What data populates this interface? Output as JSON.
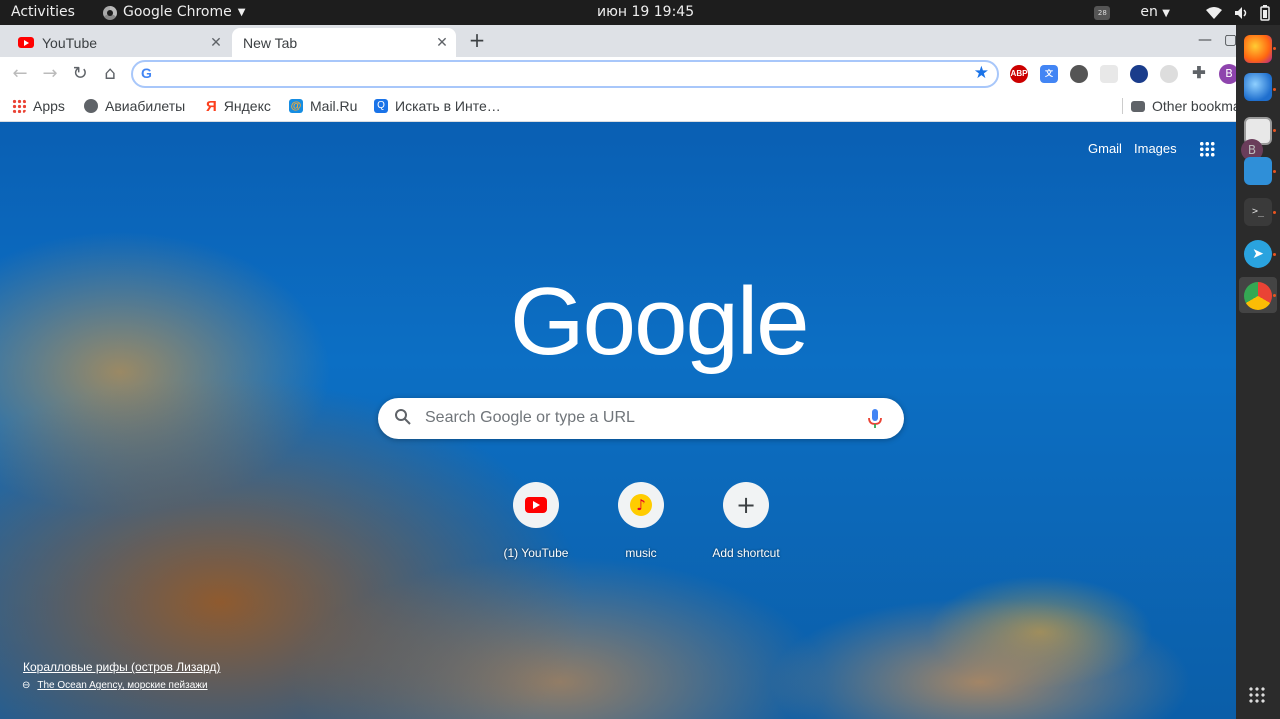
{
  "topbar": {
    "activities": "Activities",
    "app_name": "Google Chrome",
    "clock": "июн 19  19:45",
    "tray_badge": "28",
    "language": "en"
  },
  "tabs": [
    {
      "title": "YouTube",
      "icon": "youtube-icon"
    },
    {
      "title": "New Tab",
      "active": true
    }
  ],
  "omnibox": {
    "value": "",
    "icon": "google-g-icon",
    "g_letter": "G"
  },
  "extensions": [
    "adblock-plus-icon",
    "translate-icon",
    "extension-icon",
    "extension-icon",
    "globe-icon",
    "extension-icon",
    "puzzle-icon"
  ],
  "profile_initial": "B",
  "bookmarks": [
    {
      "label": "Apps",
      "icon": "apps-icon"
    },
    {
      "label": "Авиабилеты",
      "icon": "globe-icon"
    },
    {
      "label": "Яндекс",
      "icon": "yandex-icon"
    },
    {
      "label": "Mail.Ru",
      "icon": "mailru-icon"
    },
    {
      "label": "Искать в Инте…",
      "icon": "search-icon"
    }
  ],
  "other_bookmarks": "Other bookmarks",
  "ntp": {
    "gmail": "Gmail",
    "images": "Images",
    "logo": "Google",
    "search_placeholder": "Search Google or type a URL",
    "shortcuts": [
      {
        "label": "(1) YouTube",
        "icon": "youtube-icon"
      },
      {
        "label": "music",
        "icon": "music-icon"
      },
      {
        "label": "Add shortcut",
        "icon": "plus-icon"
      }
    ],
    "background_title": "Коралловые рифы (остров Лизард)",
    "background_credit": "The Ocean Agency, морские пейзажи"
  },
  "dock": [
    "firefox-icon",
    "thunderbird-icon",
    "files-icon",
    "vscode-icon",
    "terminal-icon",
    "telegram-icon",
    "chrome-icon"
  ],
  "dock_letter": "B",
  "colors": {
    "accent": "#1a73e8",
    "youtube_red": "#ff0000",
    "ubuntu_orange": "#e95420"
  }
}
